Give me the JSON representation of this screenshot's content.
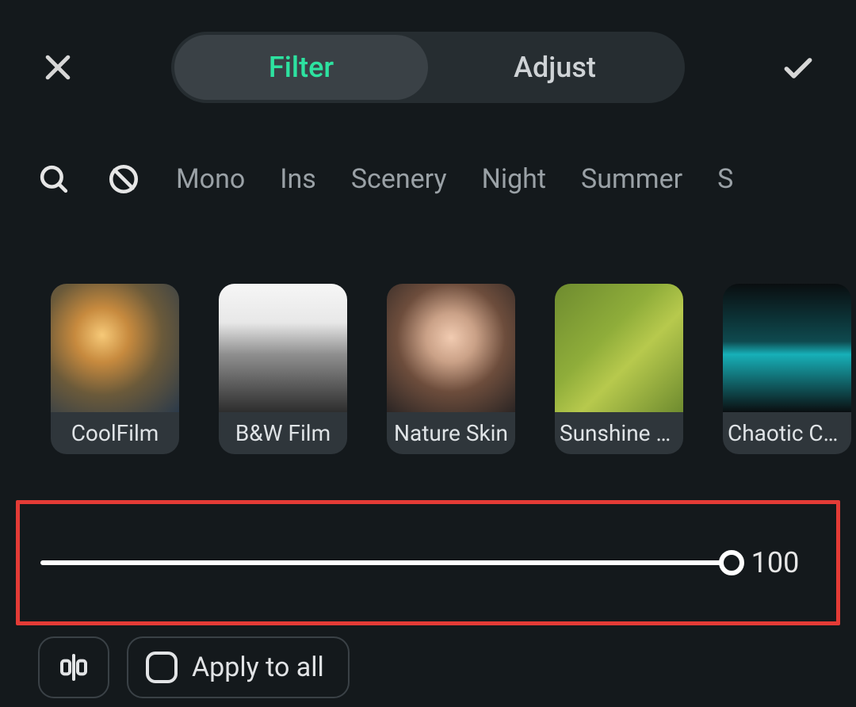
{
  "header": {
    "tabs": [
      {
        "label": "Filter",
        "active": true
      },
      {
        "label": "Adjust",
        "active": false
      }
    ]
  },
  "categories": {
    "items": [
      "Mono",
      "Ins",
      "Scenery",
      "Night",
      "Summer",
      "S"
    ]
  },
  "filters": {
    "items": [
      {
        "label": "CoolFilm",
        "thumbClass": "thumb-a"
      },
      {
        "label": "B&W Film",
        "thumbClass": "thumb-b"
      },
      {
        "label": "Nature Skin",
        "thumbClass": "thumb-c"
      },
      {
        "label": "Sunshine S…",
        "thumbClass": "thumb-d"
      },
      {
        "label": "Chaotic Car.",
        "thumbClass": "thumb-e"
      }
    ]
  },
  "slider": {
    "value": "100",
    "percent": 100
  },
  "footer": {
    "apply_all_label": "Apply to all"
  },
  "colors": {
    "accent": "#2de2a0",
    "highlight_border": "#e43b36"
  }
}
